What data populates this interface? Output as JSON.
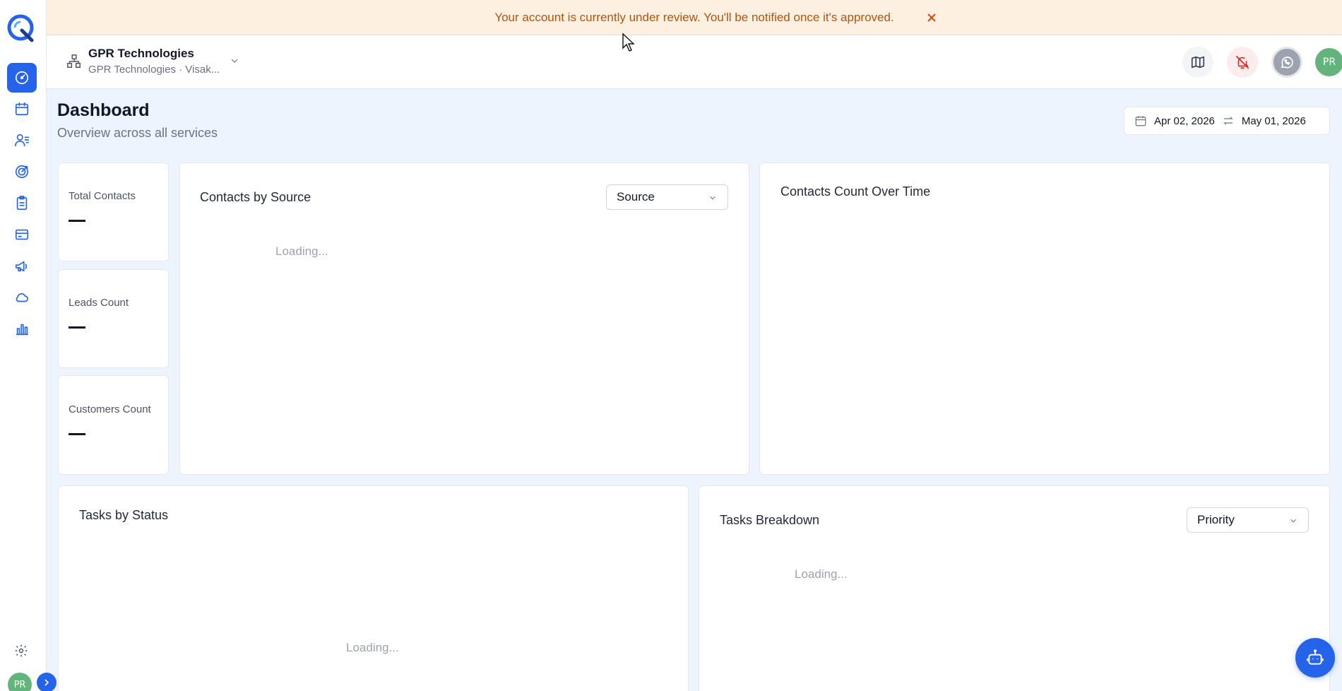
{
  "banner": {
    "message": "Your account is currently under review. You'll be notified once it's approved."
  },
  "sidebar": {
    "items": [
      {
        "icon": "dashboard-icon",
        "active": true
      },
      {
        "icon": "calendar-icon",
        "active": false
      },
      {
        "icon": "contacts-icon",
        "active": false
      },
      {
        "icon": "target-icon",
        "active": false
      },
      {
        "icon": "clipboard-icon",
        "active": false
      },
      {
        "icon": "card-icon",
        "active": false
      },
      {
        "icon": "megaphone-icon",
        "active": false
      },
      {
        "icon": "cloud-icon",
        "active": false
      },
      {
        "icon": "bar-chart-icon",
        "active": false
      }
    ],
    "avatar_initials": "PR"
  },
  "header": {
    "org_name": "GPR Technologies",
    "org_sub": "GPR Technologies · Visak...",
    "avatar_initials": "PR"
  },
  "page": {
    "title": "Dashboard",
    "subtitle": "Overview across all services"
  },
  "date_range": {
    "start": "Apr 02, 2026",
    "end": "May 01, 2026"
  },
  "stats": {
    "total_contacts_label": "Total Contacts",
    "leads_count_label": "Leads Count",
    "customers_count_label": "Customers Count"
  },
  "contacts_by_source": {
    "title": "Contacts by Source",
    "select_value": "Source",
    "loading": "Loading..."
  },
  "contacts_over_time": {
    "title": "Contacts Count Over Time"
  },
  "tasks_by_status": {
    "title": "Tasks by Status",
    "loading": "Loading..."
  },
  "tasks_breakdown": {
    "title": "Tasks Breakdown",
    "select_value": "Priority",
    "loading": "Loading..."
  },
  "colors": {
    "accent": "#2563eb",
    "banner_bg": "#fdf0e1",
    "banner_text": "#b45309",
    "avatar": "#63b37c"
  }
}
